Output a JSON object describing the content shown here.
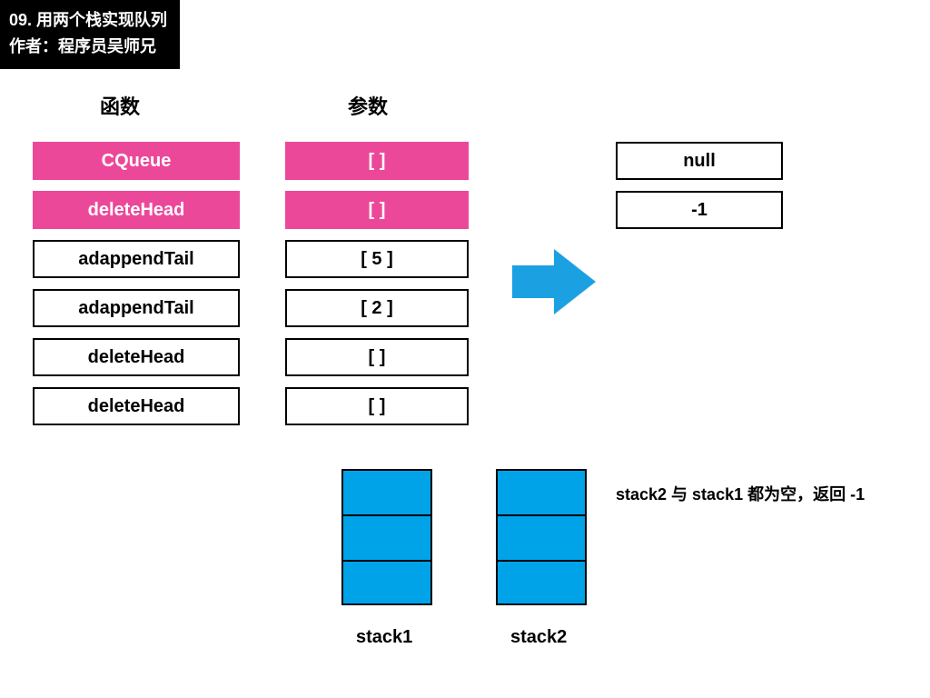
{
  "title": {
    "line1": "09. 用两个栈实现队列",
    "line2": "作者：程序员吴师兄"
  },
  "headers": {
    "func": "函数",
    "param": "参数"
  },
  "funcCol": [
    "CQueue",
    "deleteHead",
    "adappendTail",
    "adappendTail",
    "deleteHead",
    "deleteHead"
  ],
  "paramCol": [
    "[     ]",
    "[     ]",
    "[   5   ]",
    "[   2   ]",
    "[     ]",
    "[     ]"
  ],
  "highlightRows": [
    0,
    1
  ],
  "outputCol": [
    "null",
    "-1"
  ],
  "stacks": {
    "s1": "stack1",
    "s2": "stack2"
  },
  "note": "stack2 与 stack1 都为空，返回 -1",
  "colors": {
    "pink": "#ec4899",
    "blue": "#00a2e8",
    "arrow": "#1ba1e2"
  }
}
